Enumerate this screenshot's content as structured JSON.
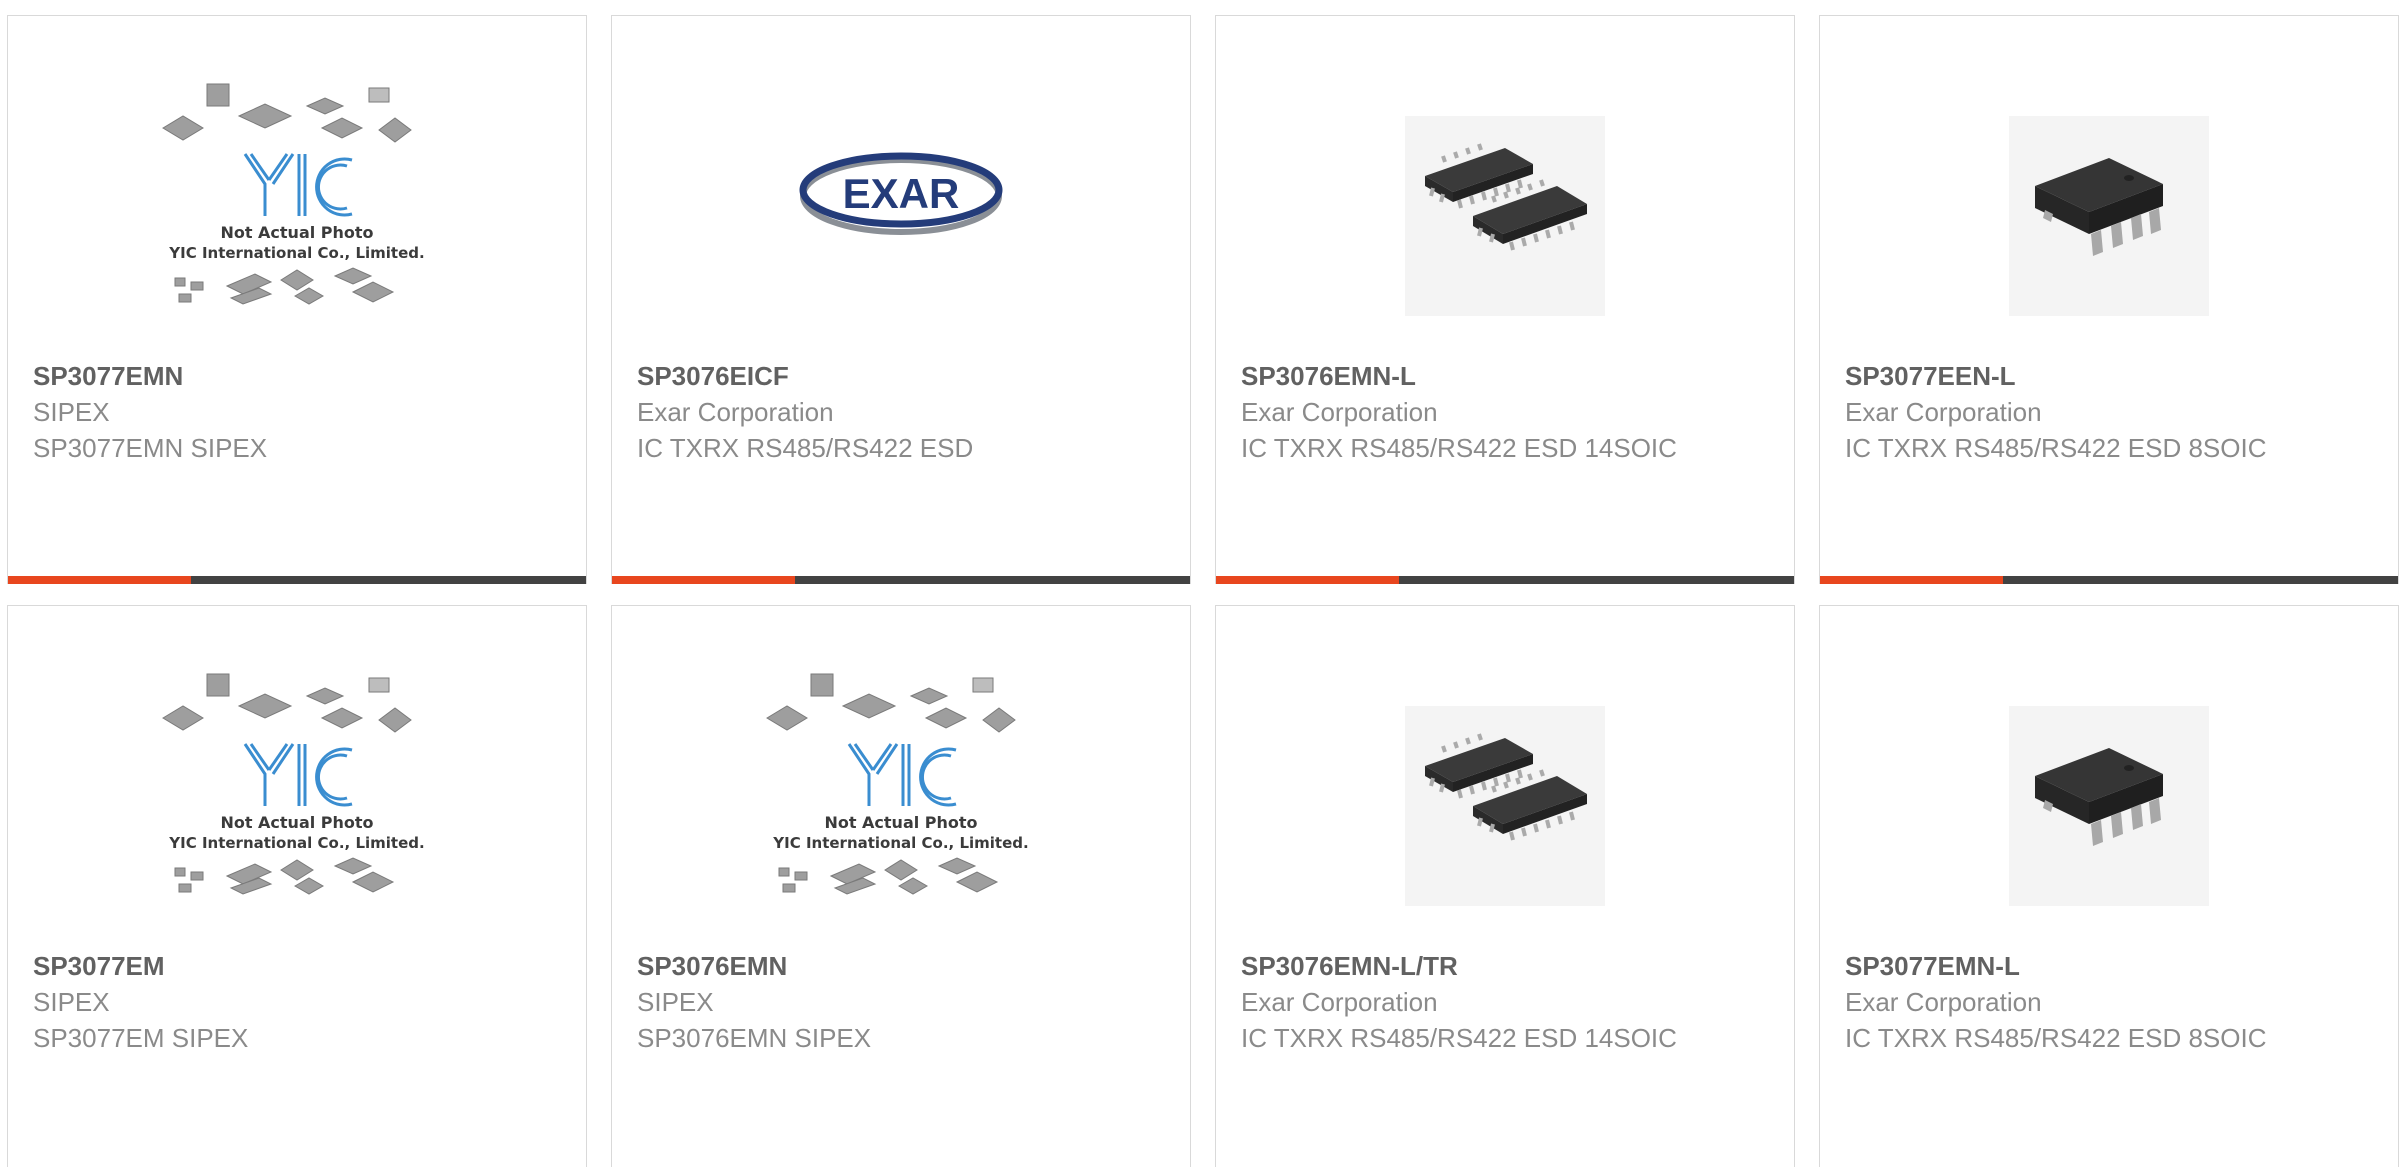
{
  "colors": {
    "accent": "#e8461e",
    "bar": "#424242",
    "part": "#616161",
    "text": "#8a8a8a",
    "border": "#d9d9d9"
  },
  "products": [
    {
      "part": "SP3077EMN",
      "maker": "SIPEX",
      "desc": "SP3077EMN SIPEX",
      "image": "yic-placeholder",
      "placeholder": {
        "line1": "Not Actual Photo",
        "line2": "YIC International Co., Limited.",
        "logo": "YIC"
      }
    },
    {
      "part": "SP3076EICF",
      "maker": "Exar Corporation",
      "desc": "IC TXRX RS485/RS422 ESD",
      "image": "exar-logo",
      "logo_text": "EXAR"
    },
    {
      "part": "SP3076EMN-L",
      "maker": "Exar Corporation",
      "desc": "IC TXRX RS485/RS422 ESD 14SOIC",
      "image": "soic14-chip"
    },
    {
      "part": "SP3077EEN-L",
      "maker": "Exar Corporation",
      "desc": "IC TXRX RS485/RS422 ESD 8SOIC",
      "image": "soic8-chip"
    },
    {
      "part": "SP3077EM",
      "maker": "SIPEX",
      "desc": "SP3077EM SIPEX",
      "image": "yic-placeholder",
      "placeholder": {
        "line1": "Not Actual Photo",
        "line2": "YIC International Co., Limited.",
        "logo": "YIC"
      }
    },
    {
      "part": "SP3076EMN",
      "maker": "SIPEX",
      "desc": "SP3076EMN SIPEX",
      "image": "yic-placeholder",
      "placeholder": {
        "line1": "Not Actual Photo",
        "line2": "YIC International Co., Limited.",
        "logo": "YIC"
      }
    },
    {
      "part": "SP3076EMN-L/TR",
      "maker": "Exar Corporation",
      "desc": "IC TXRX RS485/RS422 ESD 14SOIC",
      "image": "soic14-chip"
    },
    {
      "part": "SP3077EMN-L",
      "maker": "Exar Corporation",
      "desc": "IC TXRX RS485/RS422 ESD 8SOIC",
      "image": "soic8-chip"
    }
  ]
}
